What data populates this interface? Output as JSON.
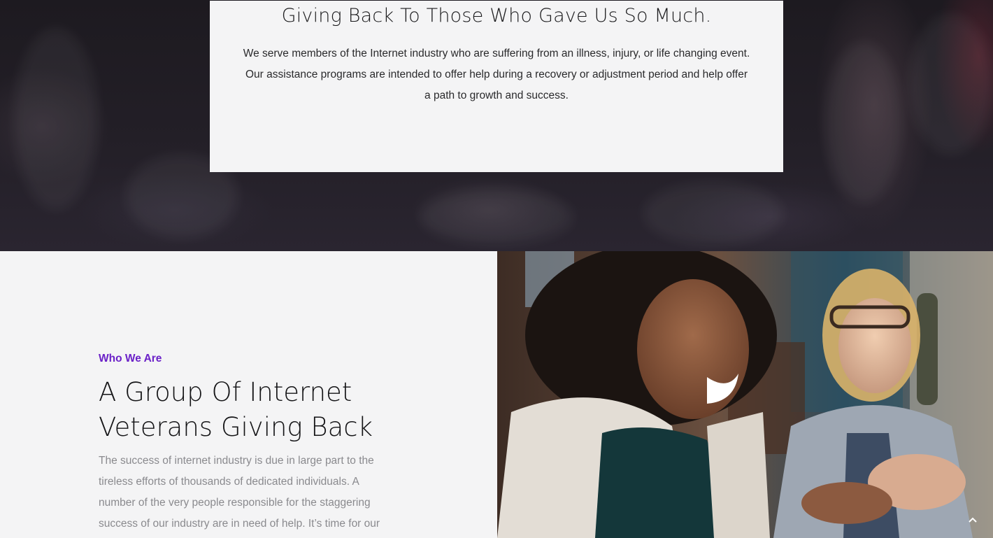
{
  "hero": {
    "title": "Giving Back To Those Who Gave Us So Much.",
    "text": "We serve members of the Internet industry who are suffering from an illness, injury, or life changing event. Our assistance programs are intended to offer help during a recovery or adjustment period and help offer a path to growth and success."
  },
  "about": {
    "eyebrow": "Who We Are",
    "title": "A Group Of Internet Veterans Giving Back",
    "text": "The success of internet industry is due in large part to the tireless efforts of thousands of dedicated individuals. A number of the very people responsible for the staggering success of our industry are in need of help. It’s time for our"
  },
  "photo": {
    "subject": "two women laughing"
  },
  "scroll_top": {
    "icon": "chevron-up-icon"
  },
  "colors": {
    "accent": "#6b21c8",
    "background": "#f4f4f5",
    "hero_dark": "#1d1a20"
  }
}
